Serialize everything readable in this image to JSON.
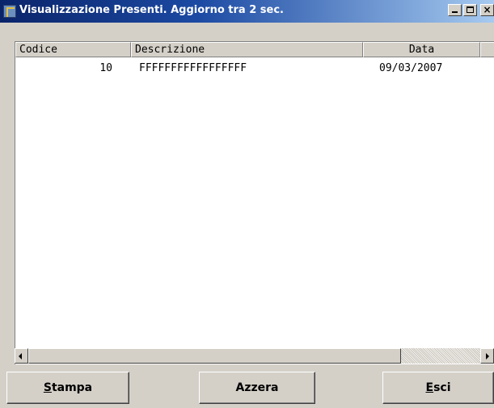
{
  "window": {
    "title": "Visualizzazione Presenti. Aggiorno tra 2 sec.",
    "controls": {
      "minimize": "_",
      "maximize": "□",
      "close": "×"
    }
  },
  "table": {
    "columns": [
      "Codice",
      "Descrizione",
      "Data"
    ],
    "rows": [
      {
        "codice": "10",
        "descrizione": "FFFFFFFFFFFFFFFFF",
        "data": "09/03/2007"
      }
    ]
  },
  "buttons": {
    "stampa": {
      "mnemonic": "S",
      "rest": "tampa"
    },
    "azzera": {
      "label": "Azzera"
    },
    "esci": {
      "mnemonic": "E",
      "rest": "sci"
    }
  },
  "colors": {
    "title_gradient_start": "#0a246a",
    "title_gradient_end": "#a6caf0",
    "face": "#d4d0c8"
  },
  "icons": [
    "app-icon",
    "minimize-icon",
    "maximize-icon",
    "close-icon",
    "scroll-left-icon",
    "scroll-right-icon"
  ]
}
